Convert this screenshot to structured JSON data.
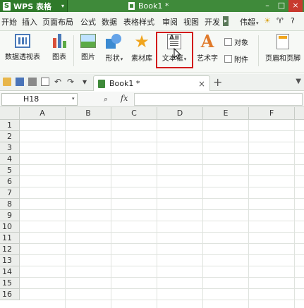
{
  "titlebar": {
    "app_logo": "S",
    "app_name": "WPS 表格",
    "app_caret": "▾",
    "document_title": "Book1 *",
    "window_controls": [
      "–",
      "□",
      "×"
    ]
  },
  "menubar": {
    "items": [
      "开始",
      "插入",
      "页面布局",
      "公式",
      "数据",
      "表格样式",
      "审阅",
      "视图",
      "开发"
    ],
    "scroll_arrow": "▸",
    "user": "伟超",
    "user_caret": "▾",
    "extra_icons": [
      "☀",
      "♈",
      "?"
    ]
  },
  "ribbon": {
    "pivot_table": "数据透视表",
    "chart": "图表",
    "picture": "图片",
    "shape": "形状",
    "library": "素材库",
    "textbox": "文本框",
    "art_text": "艺术字",
    "object": "对象",
    "attachment": "附件",
    "header_footer": "页眉和页脚",
    "textbox_glyph": "A≡",
    "art_glyph": "A",
    "star_glyph": "★",
    "dropdown_caret": "▾"
  },
  "quickbar": {
    "undo": "↶",
    "redo": "↷",
    "more": "▾"
  },
  "tabs": {
    "active_label": "Book1 *",
    "close": "×",
    "add": "+",
    "menu": "▼"
  },
  "formula_bar": {
    "cell_reference": "H18",
    "namebox_caret": "▾",
    "zoom_icon": "⌕",
    "fx_label": "fx",
    "formula": ""
  },
  "sheet": {
    "columns": [
      "A",
      "B",
      "C",
      "D",
      "E",
      "F"
    ],
    "rows": [
      "1",
      "2",
      "3",
      "4",
      "5",
      "6",
      "7",
      "8",
      "9",
      "10",
      "11",
      "12",
      "13",
      "14",
      "15",
      "16"
    ]
  },
  "colors": {
    "title_green": "#3f8a3a",
    "highlight_red": "#d21b1b"
  }
}
